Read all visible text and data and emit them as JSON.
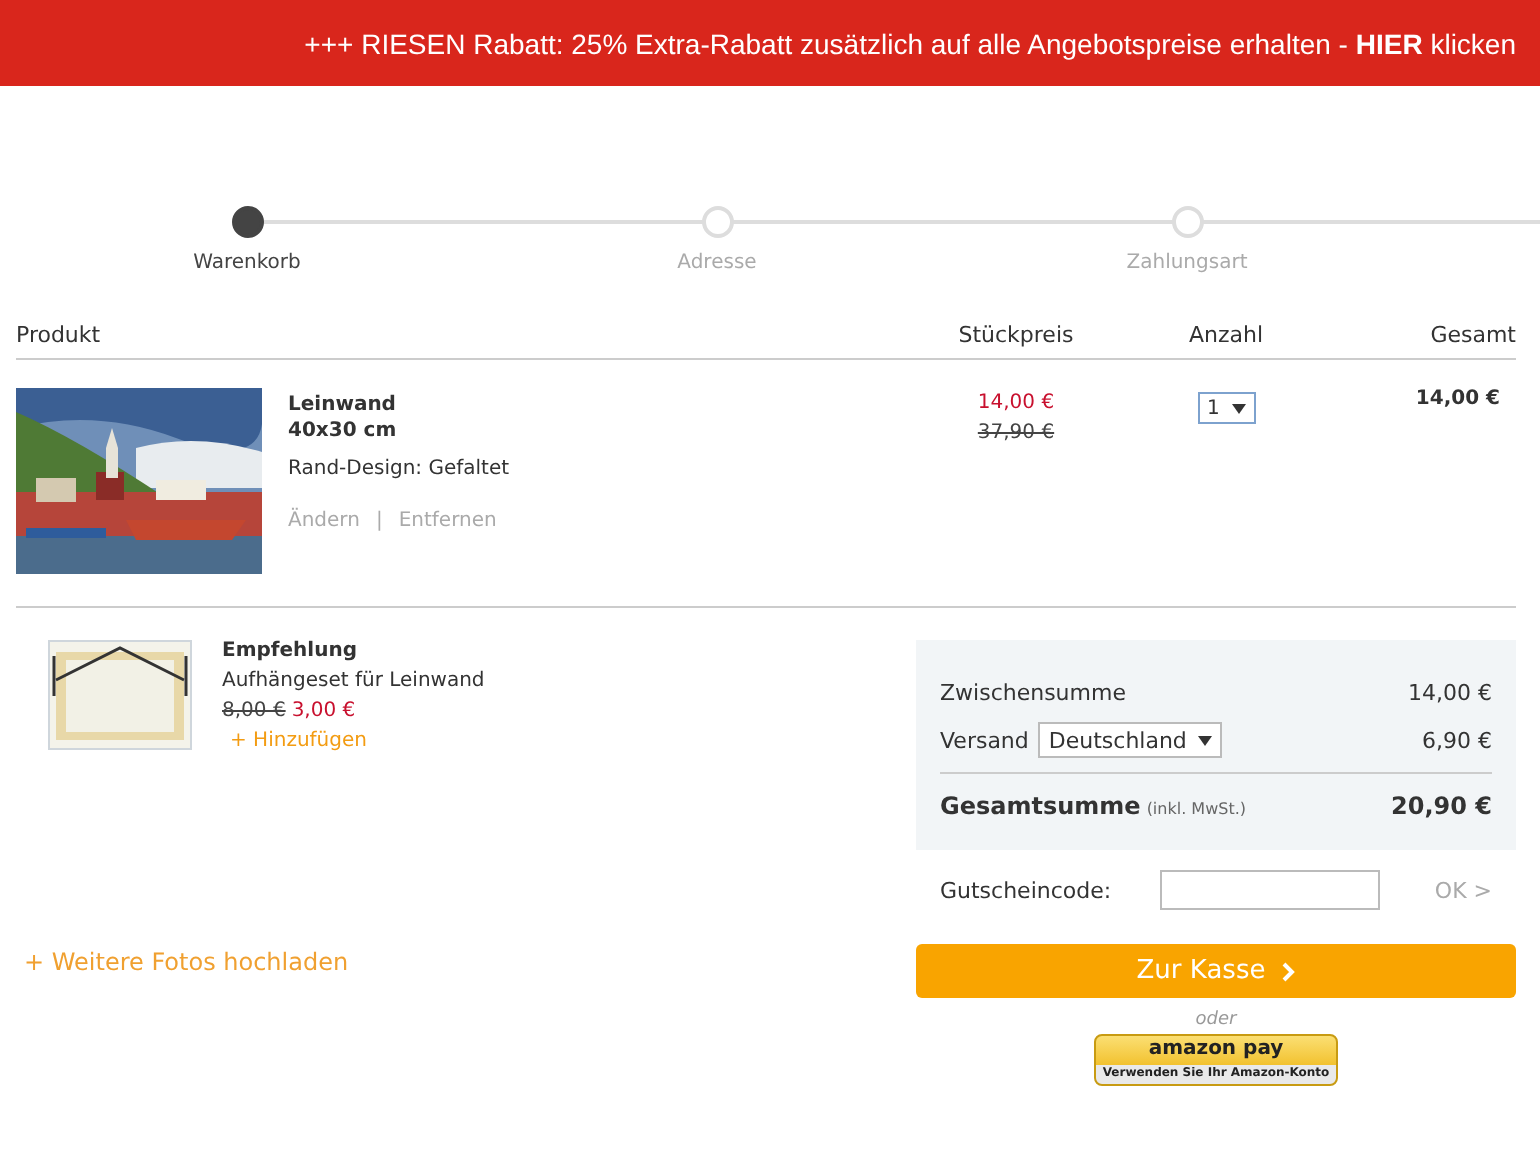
{
  "banner": {
    "text": "+++ RIESEN Rabatt: 25% Extra-Rabatt zusätzlich auf alle Angebotspreise erhalten - **HIER** klicken"
  },
  "steps": [
    {
      "label": "Warenkorb",
      "selected": true
    },
    {
      "label": "Adresse",
      "selected": false
    },
    {
      "label": "Zahlungsart",
      "selected": false
    }
  ],
  "table": {
    "columns": [
      "Produkt",
      "Stückpreis",
      "Anzahl",
      "Gesamt"
    ],
    "rows": [
      {
        "title": "Leinwand",
        "size": "40x30 cm",
        "option": "Rand-Design: Gefaltet",
        "actions": [
          "Ändern",
          "Entfernen"
        ],
        "separator": "|",
        "price": "14,00 €",
        "old_price": "37,90 €",
        "quantity": "1",
        "total": "14,00 €"
      }
    ]
  },
  "recommendation": {
    "heading": "Empfehlung",
    "name": "Aufhängeset für Leinwand",
    "old_price": "8,00 €",
    "price": "3,00 €",
    "add": "+ Hinzufügen"
  },
  "upload_link": "+ Weitere Fotos hochladen",
  "summary": {
    "subtotal_label": "Zwischensumme",
    "subtotal": "14,00 €",
    "shipping_label": "Versand",
    "shipping_country": "Deutschland",
    "shipping": "6,90 €",
    "total_label": "Gesamtsumme",
    "total_note": "(inkl. MwSt.)",
    "total": "20,90 €"
  },
  "coupon": {
    "label": "Gutscheincode:",
    "submit": "OK >"
  },
  "checkout": {
    "button": "Zur Kasse",
    "or": "oder",
    "amazon_pay": {
      "logo": "amazon pay",
      "caption": "Verwenden Sie Ihr Amazon-Konto"
    }
  }
}
